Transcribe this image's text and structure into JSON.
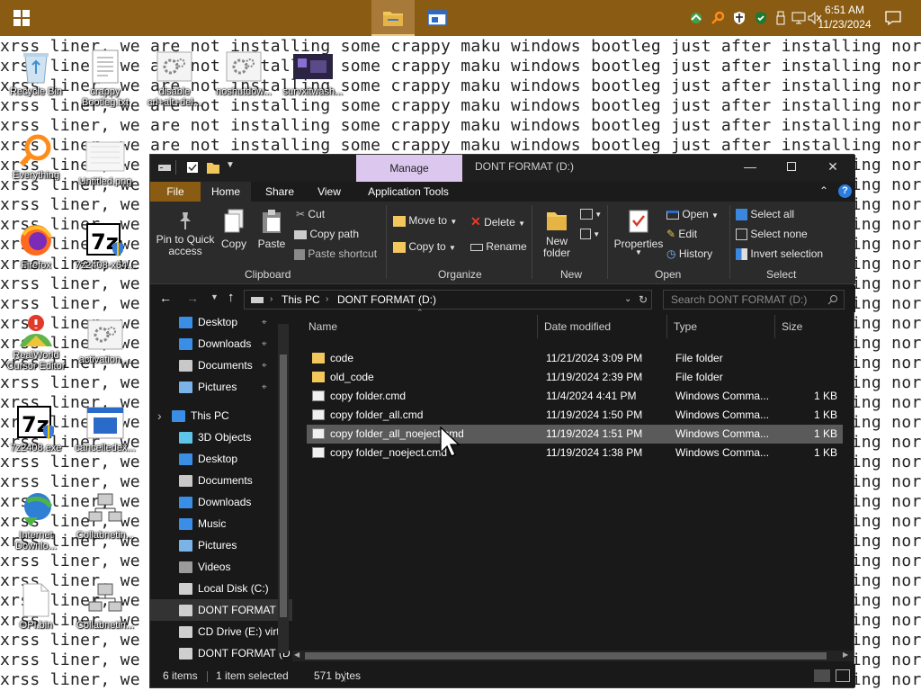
{
  "taskbar": {
    "start": "windows-logo",
    "apps": [
      "file-explorer",
      "window-app"
    ],
    "tray_icons": [
      "network-share-icon",
      "search-magnifier-icon",
      "defender-shield-icon",
      "security-shield-icon",
      "usb-icon",
      "network-icon",
      "volume-muted-icon"
    ],
    "time": "6:51 AM",
    "date": "11/23/2024",
    "notifications": "action-center"
  },
  "wallpaper": {
    "lines": [
      "xrss liner, we are not installing some crappy maku windows bootleg just after installing normal windows",
      "xrss liner, we are not installing some crappy maku windows bootleg just after installing normal windows",
      "xrss liner, we are not installing some crappy maku windows bootleg just after installing normal windows",
      "xrss liner, we are not installing some crappy maku windows bootleg just after installing normal windows",
      "xrss liner, we are not installing some crappy maku windows bootleg just after installing normal windows",
      "xrss liner, we are not installing some crappy maku windows bootleg just after installing normal windows",
      "xrss liner, we are not installing some crappy maku windows bootleg just after installing normal windows",
      "xrss liner, we are not installing some crappy maku windows bootleg just after installing normal windows",
      "xrss liner, we are not installing some crappy maku windows bootleg just after installing normal windows",
      "xrss liner, we are not installing some crappy maku windows bootleg just after installing normal windows",
      "xrss liner, we are not installing some crappy maku windows bootleg just after installing normal windows",
      "xrss liner, we are not installing some crappy maku windows bootleg just after installing normal windows",
      "xrss liner, we are not installing some crappy maku windows bootleg just after installing normal windows",
      "xrss liner, we are not installing some crappy maku windows bootleg just after installing normal windows",
      "xrss liner, we are not installing some crappy maku windows bootleg just after installing normal windows",
      "xrss liner, we are not installing some crappy maku windows bootleg just after installing normal windows",
      "xrss liner, we are not installing some crappy maku windows bootleg just after installing normal windows",
      "xrss liner, we are not installing some crappy maku windows bootleg just after installing normal windows",
      "xrss liner, we are not installing some crappy maku windows bootleg just after installing normal windows",
      "xrss liner, we are not installing some crappy maku windows bootleg just after installing normal windows",
      "xrss liner, we are not installing some crappy maku windows bootleg just after installing normal windows",
      "xrss liner, we are not installing some crappy maku windows bootleg just after installing normal windows",
      "xrss liner, we are not installing some crappy maku windows bootleg just after installing normal windows",
      "xrss liner, we are not installing some crappy maku windows bootleg just after installing normal windows",
      "xrss liner, we are not installing some crappy maku windows bootleg just after installing normal windows",
      "xrss liner, we are not installing some crappy maku windows bootleg just after installing normal windows",
      "xrss liner, we are not installing some crappy maku windows bootleg just after installing normal windows",
      "xrss liner, we are not installing some crappy maku windows bootleg just after installing normal windows",
      "xrss liner, we are not installing some crappy maku windows bootleg just after installing normal windows",
      "xrss liner, we are not installing some crappy maku windows bootleg just after installing normal windows",
      "xrss liner, we are not installing some crappy maku windows bootleg just after installing normal windows",
      "xrss liner, we are not installing some crappy maku windows bootleg just after installing normal windows",
      "xrss liner, we are not installing some crappy maku windows bootleg just after installing normal windows",
      "xrss liner, we are not installing some crappy maku windows bootleg just after installing normal windows"
    ]
  },
  "desktop_icons": [
    {
      "label": "Recycle Bin",
      "icon": "recycle-bin"
    },
    {
      "label": "crappy\nBootleg.txt",
      "icon": "text-file"
    },
    {
      "label": "disable\ncrl+alt+del...",
      "icon": "gear-script"
    },
    {
      "label": "noshutdow...",
      "icon": "gear-script"
    },
    {
      "label": "survxitwash...",
      "icon": "image-thumbnail"
    },
    {
      "label": "Everything",
      "icon": "everything-search"
    },
    {
      "label": "Untitled.png",
      "icon": "image-file"
    },
    {
      "label": "Firefox",
      "icon": "firefox"
    },
    {
      "label": "7z2408-x64...",
      "icon": "7zip-installer"
    },
    {
      "label": "RealWorld\nCursor Editor",
      "icon": "cursor-editor"
    },
    {
      "label": "activation ...",
      "icon": "gear-script"
    },
    {
      "label": "7z2408.exe",
      "icon": "7zip-installer"
    },
    {
      "label": "cancelledex...",
      "icon": "window-app"
    },
    {
      "label": "Internet\nDownlo...",
      "icon": "idm"
    },
    {
      "label": "Collabnetin...",
      "icon": "network-computers"
    },
    {
      "label": "OPI.bin",
      "icon": "blank-file"
    },
    {
      "label": "Collabnetin...",
      "icon": "network-computers"
    }
  ],
  "explorer": {
    "quick_access_icons": [
      "properties-icon",
      "new-folder-icon",
      "dropdown-icon"
    ],
    "manage_tab": "Manage",
    "title": "DONT FORMAT (D:)",
    "tabs": [
      "File",
      "Home",
      "Share",
      "View",
      "Application Tools"
    ],
    "ribbon": {
      "clipboard": {
        "pin": "Pin to Quick\naccess",
        "copy": "Copy",
        "paste": "Paste",
        "cut": "Cut",
        "copy_path": "Copy path",
        "paste_shortcut": "Paste shortcut",
        "group": "Clipboard"
      },
      "organize": {
        "move_to": "Move to",
        "copy_to": "Copy to",
        "delete": "Delete",
        "rename": "Rename",
        "group": "Organize"
      },
      "new": {
        "new_folder": "New\nfolder",
        "group": "New"
      },
      "open": {
        "properties": "Properties",
        "open": "Open",
        "edit": "Edit",
        "history": "History",
        "group": "Open"
      },
      "select": {
        "select_all": "Select all",
        "select_none": "Select none",
        "invert": "Invert selection",
        "group": "Select"
      }
    },
    "address": {
      "crumbs": [
        "This PC",
        "DONT FORMAT (D:)"
      ]
    },
    "search_placeholder": "Search DONT FORMAT (D:)",
    "nav": [
      {
        "label": "Desktop",
        "icon": "desktop",
        "pinned": true
      },
      {
        "label": "Downloads",
        "icon": "downloads",
        "pinned": true
      },
      {
        "label": "Documents",
        "icon": "documents",
        "pinned": true
      },
      {
        "label": "Pictures",
        "icon": "pictures",
        "pinned": true
      },
      {
        "label": "This PC",
        "icon": "this-pc"
      },
      {
        "label": "3D Objects",
        "icon": "3d-objects"
      },
      {
        "label": "Desktop",
        "icon": "desktop"
      },
      {
        "label": "Documents",
        "icon": "documents"
      },
      {
        "label": "Downloads",
        "icon": "downloads"
      },
      {
        "label": "Music",
        "icon": "music"
      },
      {
        "label": "Pictures",
        "icon": "pictures"
      },
      {
        "label": "Videos",
        "icon": "videos"
      },
      {
        "label": "Local Disk (C:)",
        "icon": "drive"
      },
      {
        "label": "DONT FORMAT (",
        "icon": "drive",
        "selected": true
      },
      {
        "label": "CD Drive (E:) virt",
        "icon": "cd-drive"
      },
      {
        "label": "DONT FORMAT (D",
        "icon": "drive"
      }
    ],
    "columns": [
      "Name",
      "Date modified",
      "Type",
      "Size"
    ],
    "files": [
      {
        "name": "code",
        "date": "11/21/2024 3:09 PM",
        "type": "File folder",
        "size": "",
        "icon": "folder"
      },
      {
        "name": "old_code",
        "date": "11/19/2024 2:39 PM",
        "type": "File folder",
        "size": "",
        "icon": "folder"
      },
      {
        "name": "copy folder.cmd",
        "date": "11/4/2024 4:41 PM",
        "type": "Windows Comma...",
        "size": "1 KB",
        "icon": "cmd"
      },
      {
        "name": "copy folder_all.cmd",
        "date": "11/19/2024 1:50 PM",
        "type": "Windows Comma...",
        "size": "1 KB",
        "icon": "cmd"
      },
      {
        "name": "copy folder_all_noeject.cmd",
        "date": "11/19/2024 1:51 PM",
        "type": "Windows Comma...",
        "size": "1 KB",
        "icon": "cmd",
        "selected": true
      },
      {
        "name": "copy folder_noeject.cmd",
        "date": "11/19/2024 1:38 PM",
        "type": "Windows Comma...",
        "size": "1 KB",
        "icon": "cmd"
      }
    ],
    "status": {
      "items": "6 items",
      "selected": "1 item selected",
      "size": "571 bytes"
    },
    "view_icons": [
      "details-view",
      "large-icons-view"
    ]
  },
  "colors": {
    "taskbar": "#8a5b12",
    "explorer_bg": "#191919",
    "ribbon_bg": "#2b2b2b",
    "manage_tab": "#dcc7ef",
    "selection": "#5a5a5a",
    "folder": "#f2c75c"
  }
}
